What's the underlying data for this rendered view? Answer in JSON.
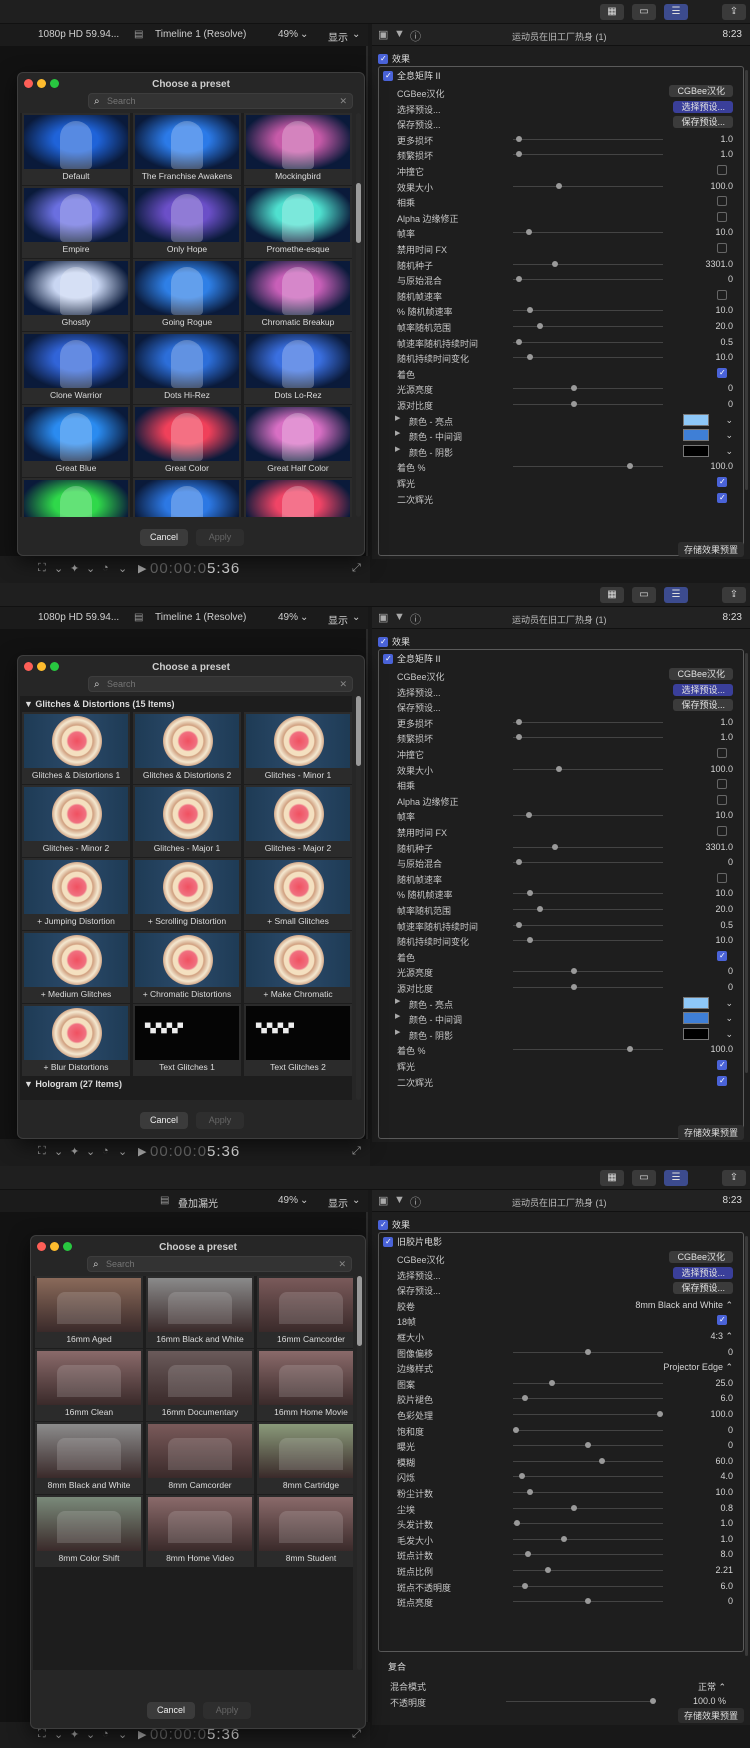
{
  "topbar": {
    "icons": [
      "grid-icon",
      "filmstrip-icon",
      "sliders-icon",
      "share-icon"
    ]
  },
  "sections": [
    {
      "viewer": {
        "format": "1080p HD 59.94...",
        "timeline": "Timeline 1 (Resolve)",
        "zoom": "49%",
        "display": "显示"
      },
      "inspector": {
        "title": "运动员在旧工厂热身 (1)",
        "time": "8:23",
        "effects_label": "效果",
        "effect_name": "全息矩阵 II",
        "save_preset": "存储效果预置",
        "params": [
          {
            "label": "CGBee汉化",
            "type": "button",
            "value": "CGBee汉化"
          },
          {
            "label": "选择预设...",
            "type": "button-blue",
            "value": "选择预设..."
          },
          {
            "label": "保存预设...",
            "type": "button",
            "value": "保存预设..."
          },
          {
            "label": "更多损坏",
            "type": "slider",
            "value": "1.0",
            "pos": 0.02
          },
          {
            "label": "频繁损坏",
            "type": "slider",
            "value": "1.0",
            "pos": 0.02
          },
          {
            "label": "冲撞它",
            "type": "checkbox",
            "checked": false
          },
          {
            "label": "效果大小",
            "type": "slider",
            "value": "100.0",
            "pos": 0.3
          },
          {
            "label": "相乘",
            "type": "checkbox",
            "checked": false
          },
          {
            "label": "Alpha 边缘修正",
            "type": "checkbox",
            "checked": false
          },
          {
            "label": "帧率",
            "type": "slider",
            "value": "10.0",
            "pos": 0.09
          },
          {
            "label": "禁用时间 FX",
            "type": "checkbox",
            "checked": false
          },
          {
            "label": "随机种子",
            "type": "slider",
            "value": "3301.0",
            "pos": 0.27
          },
          {
            "label": "与原始混合",
            "type": "slider",
            "value": "0",
            "pos": 0.02
          },
          {
            "label": "随机帧速率",
            "type": "checkbox",
            "checked": false
          },
          {
            "label": "% 随机帧速率",
            "type": "slider",
            "value": "10.0",
            "pos": 0.1
          },
          {
            "label": "帧率随机范围",
            "type": "slider",
            "value": "20.0",
            "pos": 0.17
          },
          {
            "label": "帧速率随机持续时间",
            "type": "slider",
            "value": "0.5",
            "pos": 0.02
          },
          {
            "label": "随机持续时间变化",
            "type": "slider",
            "value": "10.0",
            "pos": 0.1
          },
          {
            "label": "着色",
            "type": "checkbox",
            "checked": true
          },
          {
            "label": "光源亮度",
            "type": "slider",
            "value": "0",
            "pos": 0.4
          },
          {
            "label": "源对比度",
            "type": "slider",
            "value": "0",
            "pos": 0.4
          },
          {
            "label": "颜色 - 亮点",
            "type": "color",
            "color": "#8ec8f8"
          },
          {
            "label": "颜色 - 中间调",
            "type": "color",
            "color": "#3f7fd6"
          },
          {
            "label": "颜色 - 阴影",
            "type": "color",
            "color": "#000000"
          },
          {
            "label": "着色 %",
            "type": "slider",
            "value": "100.0",
            "pos": 0.79
          },
          {
            "label": "辉光",
            "type": "checkbox",
            "checked": true
          },
          {
            "label": "二次辉光",
            "type": "checkbox",
            "checked": true
          }
        ]
      },
      "dialog": {
        "title": "Choose a preset",
        "search_placeholder": "Search",
        "cancel": "Cancel",
        "apply": "Apply",
        "category": "",
        "tiles": [
          {
            "label": "Default",
            "color": "#1f63d9"
          },
          {
            "label": "The Franchise Awakens",
            "color": "#2b7ae8"
          },
          {
            "label": "Mockingbird",
            "color": "#c65aa8"
          },
          {
            "label": "Empire",
            "color": "#6a6fe0"
          },
          {
            "label": "Only Hope",
            "color": "#6b4fc8"
          },
          {
            "label": "Promethe-esque",
            "color": "#4fe0cf"
          },
          {
            "label": "Ghostly",
            "color": "#c9d6f2"
          },
          {
            "label": "Going Rogue",
            "color": "#2e7fe6"
          },
          {
            "label": "Chromatic Breakup",
            "color": "#c85fb8"
          },
          {
            "label": "Clone Warrior",
            "color": "#3164d8"
          },
          {
            "label": "Dots Hi-Rez",
            "color": "#2c6ed9"
          },
          {
            "label": "Dots Lo-Rez",
            "color": "#3a6fe0"
          },
          {
            "label": "Great Blue",
            "color": "#2a8bf0"
          },
          {
            "label": "Great Color",
            "color": "#f0405a"
          },
          {
            "label": "Great Half Color",
            "color": "#d86fc4"
          },
          {
            "label": "",
            "color": "#2fd84a"
          },
          {
            "label": "",
            "color": "#2c78e4"
          },
          {
            "label": "",
            "color": "#f04466"
          }
        ]
      },
      "timecode": {
        "dim": "00:00:0",
        "bright": "5:36"
      }
    },
    {
      "viewer": {
        "format": "1080p HD 59.94...",
        "timeline": "Timeline 1 (Resolve)",
        "zoom": "49%",
        "display": "显示"
      },
      "inspector": {
        "title": "运动员在旧工厂热身 (1)",
        "time": "8:23",
        "effects_label": "效果",
        "effect_name": "全息矩阵 II",
        "save_preset": "存储效果预置",
        "params": [
          {
            "label": "CGBee汉化",
            "type": "button",
            "value": "CGBee汉化"
          },
          {
            "label": "选择预设...",
            "type": "button-blue",
            "value": "选择预设..."
          },
          {
            "label": "保存预设...",
            "type": "button",
            "value": "保存预设..."
          },
          {
            "label": "更多损坏",
            "type": "slider",
            "value": "1.0",
            "pos": 0.02
          },
          {
            "label": "频繁损坏",
            "type": "slider",
            "value": "1.0",
            "pos": 0.02
          },
          {
            "label": "冲撞它",
            "type": "checkbox",
            "checked": false
          },
          {
            "label": "效果大小",
            "type": "slider",
            "value": "100.0",
            "pos": 0.3
          },
          {
            "label": "相乘",
            "type": "checkbox",
            "checked": false
          },
          {
            "label": "Alpha 边缘修正",
            "type": "checkbox",
            "checked": false
          },
          {
            "label": "帧率",
            "type": "slider",
            "value": "10.0",
            "pos": 0.09
          },
          {
            "label": "禁用时间 FX",
            "type": "checkbox",
            "checked": false
          },
          {
            "label": "随机种子",
            "type": "slider",
            "value": "3301.0",
            "pos": 0.27
          },
          {
            "label": "与原始混合",
            "type": "slider",
            "value": "0",
            "pos": 0.02
          },
          {
            "label": "随机帧速率",
            "type": "checkbox",
            "checked": false
          },
          {
            "label": "% 随机帧速率",
            "type": "slider",
            "value": "10.0",
            "pos": 0.1
          },
          {
            "label": "帧率随机范围",
            "type": "slider",
            "value": "20.0",
            "pos": 0.17
          },
          {
            "label": "帧速率随机持续时间",
            "type": "slider",
            "value": "0.5",
            "pos": 0.02
          },
          {
            "label": "随机持续时间变化",
            "type": "slider",
            "value": "10.0",
            "pos": 0.1
          },
          {
            "label": "着色",
            "type": "checkbox",
            "checked": true
          },
          {
            "label": "光源亮度",
            "type": "slider",
            "value": "0",
            "pos": 0.4
          },
          {
            "label": "源对比度",
            "type": "slider",
            "value": "0",
            "pos": 0.4
          },
          {
            "label": "颜色 - 亮点",
            "type": "color",
            "color": "#8ec8f8"
          },
          {
            "label": "颜色 - 中间调",
            "type": "color",
            "color": "#3f7fd6"
          },
          {
            "label": "颜色 - 阴影",
            "type": "color",
            "color": "#000000"
          },
          {
            "label": "着色 %",
            "type": "slider",
            "value": "100.0",
            "pos": 0.79
          },
          {
            "label": "辉光",
            "type": "checkbox",
            "checked": true
          },
          {
            "label": "二次辉光",
            "type": "checkbox",
            "checked": true
          }
        ]
      },
      "dialog": {
        "title": "Choose a preset",
        "search_placeholder": "Search",
        "cancel": "Cancel",
        "apply": "Apply",
        "category": "Glitches & Distortions (15 Items)",
        "category2": "Hologram (27 Items)",
        "tiles": [
          {
            "label": "Glitches & Distortions 1",
            "color": "#e8d0a0"
          },
          {
            "label": "Glitches & Distortions 2",
            "color": "#e8d0a0"
          },
          {
            "label": "Glitches - Minor 1",
            "color": "#e8d0a0"
          },
          {
            "label": "Glitches - Minor 2",
            "color": "#e8d0a0"
          },
          {
            "label": "Glitches - Major 1",
            "color": "#e8d0a0"
          },
          {
            "label": "Glitches - Major 2",
            "color": "#e8d0a0"
          },
          {
            "label": "+ Jumping Distortion",
            "color": "#e8d0a0"
          },
          {
            "label": "+ Scrolling Distortion",
            "color": "#e8d0a0"
          },
          {
            "label": "+ Small Glitches",
            "color": "#e8d0a0"
          },
          {
            "label": "+ Medium Glitches",
            "color": "#e8d0a0"
          },
          {
            "label": "+ Chromatic Distortions",
            "color": "#e8d0a0"
          },
          {
            "label": "+ Make Chromatic",
            "color": "#e8c0a0"
          },
          {
            "label": "+ Blur Distortions",
            "color": "#e8c8a0"
          },
          {
            "label": "Text Glitches 1",
            "color": "#000000"
          },
          {
            "label": "Text Glitches 2",
            "color": "#000000"
          }
        ]
      },
      "timecode": {
        "dim": "00:00:0",
        "bright": "5:36"
      }
    },
    {
      "viewer": {
        "format": "",
        "timeline": "叠加漏光",
        "zoom": "49%",
        "display": "显示"
      },
      "inspector": {
        "title": "运动员在旧工厂热身 (1)",
        "time": "8:23",
        "effects_label": "效果",
        "effect_name": "旧胶片电影",
        "save_preset": "存储效果预置",
        "params": [
          {
            "label": "CGBee汉化",
            "type": "button",
            "value": "CGBee汉化"
          },
          {
            "label": "选择预设...",
            "type": "button-blue",
            "value": "选择预设..."
          },
          {
            "label": "保存预设...",
            "type": "button",
            "value": "保存预设..."
          },
          {
            "label": "胶卷",
            "type": "dropdown",
            "value": "8mm Black and White ⌃"
          },
          {
            "label": "18帧",
            "type": "checkbox",
            "checked": true
          },
          {
            "label": "框大小",
            "type": "dropdown",
            "value": "4:3 ⌃"
          },
          {
            "label": "图像偏移",
            "type": "slider",
            "value": "0",
            "pos": 0.5
          },
          {
            "label": "边缘样式",
            "type": "dropdown",
            "value": "Projector Edge ⌃"
          },
          {
            "label": "图案",
            "type": "slider",
            "value": "25.0",
            "pos": 0.25
          },
          {
            "label": "胶片褪色",
            "type": "slider",
            "value": "6.0",
            "pos": 0.06
          },
          {
            "label": "色彩处理",
            "type": "slider",
            "value": "100.0",
            "pos": 1.0
          },
          {
            "label": "饱和度",
            "type": "slider",
            "value": "0",
            "pos": 0.0
          },
          {
            "label": "曝光",
            "type": "slider",
            "value": "0",
            "pos": 0.5
          },
          {
            "label": "模糊",
            "type": "slider",
            "value": "60.0",
            "pos": 0.6
          },
          {
            "label": "闪烁",
            "type": "slider",
            "value": "4.0",
            "pos": 0.04
          },
          {
            "label": "粉尘计数",
            "type": "slider",
            "value": "10.0",
            "pos": 0.1
          },
          {
            "label": "尘埃",
            "type": "slider",
            "value": "0.8",
            "pos": 0.4
          },
          {
            "label": "头发计数",
            "type": "slider",
            "value": "1.0",
            "pos": 0.01
          },
          {
            "label": "毛发大小",
            "type": "slider",
            "value": "1.0",
            "pos": 0.33
          },
          {
            "label": "斑点计数",
            "type": "slider",
            "value": "8.0",
            "pos": 0.08
          },
          {
            "label": "斑点比例",
            "type": "slider",
            "value": "2.21",
            "pos": 0.22
          },
          {
            "label": "斑点不透明度",
            "type": "slider",
            "value": "6.0",
            "pos": 0.06
          },
          {
            "label": "斑点亮度",
            "type": "slider",
            "value": "0",
            "pos": 0.5
          }
        ],
        "blend": {
          "header": "复合",
          "mode_label": "混合模式",
          "mode_value": "正常 ⌃",
          "opacity_label": "不透明度",
          "opacity_value": "100.0 %"
        }
      },
      "dialog": {
        "title": "Choose a preset",
        "search_placeholder": "Search",
        "cancel": "Cancel",
        "apply": "Apply",
        "category": "",
        "tiles": [
          {
            "label": "16mm Aged",
            "color": "#8a6a5a"
          },
          {
            "label": "16mm Black and White",
            "color": "#8a8a8a"
          },
          {
            "label": "16mm Camcorder",
            "color": "#7a5a5a"
          },
          {
            "label": "16mm Clean",
            "color": "#8a6a6a"
          },
          {
            "label": "16mm Documentary",
            "color": "#6a5a5a"
          },
          {
            "label": "16mm Home Movie",
            "color": "#8a6a6a"
          },
          {
            "label": "8mm Black and White",
            "color": "#8c8c8c"
          },
          {
            "label": "8mm Camcorder",
            "color": "#7a5a5a"
          },
          {
            "label": "8mm Cartridge",
            "color": "#8a9a7a"
          },
          {
            "label": "8mm Color Shift",
            "color": "#7a8a7a"
          },
          {
            "label": "8mm Home Video",
            "color": "#8a6a6a"
          },
          {
            "label": "8mm Student",
            "color": "#8a6a6a"
          }
        ]
      },
      "timecode": {
        "dim": "00:00:0",
        "bright": "5:36"
      }
    }
  ]
}
